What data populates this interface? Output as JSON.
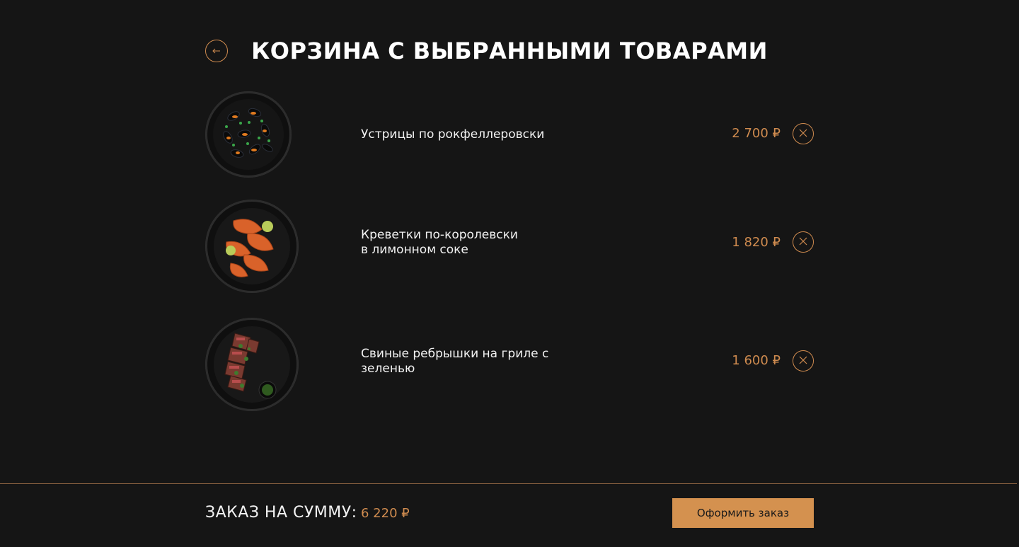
{
  "page": {
    "title": "КОРЗИНА С ВЫБРАННЫМИ ТОВАРАМИ",
    "back_icon": "arrow-left-icon"
  },
  "cart": {
    "items": [
      {
        "name": "Устрицы по рокфеллеровски",
        "price": "2 700 ₽",
        "image": "mussels-dish"
      },
      {
        "name": "Креветки по-королевски\nв лимонном соке",
        "price": "1 820 ₽",
        "image": "shrimp-dish"
      },
      {
        "name": "Свиные ребрышки на гриле с\nзеленью",
        "price": "1 600 ₽",
        "image": "ribs-dish"
      }
    ],
    "remove_icon": "close-icon"
  },
  "footer": {
    "total_label": "ЗАКАЗ НА СУММУ:",
    "total_value": "6 220 ₽",
    "checkout_label": "Оформить заказ"
  },
  "colors": {
    "background": "#151515",
    "accent": "#cf8b4f",
    "button": "#d4914f",
    "text": "#ffffff"
  }
}
